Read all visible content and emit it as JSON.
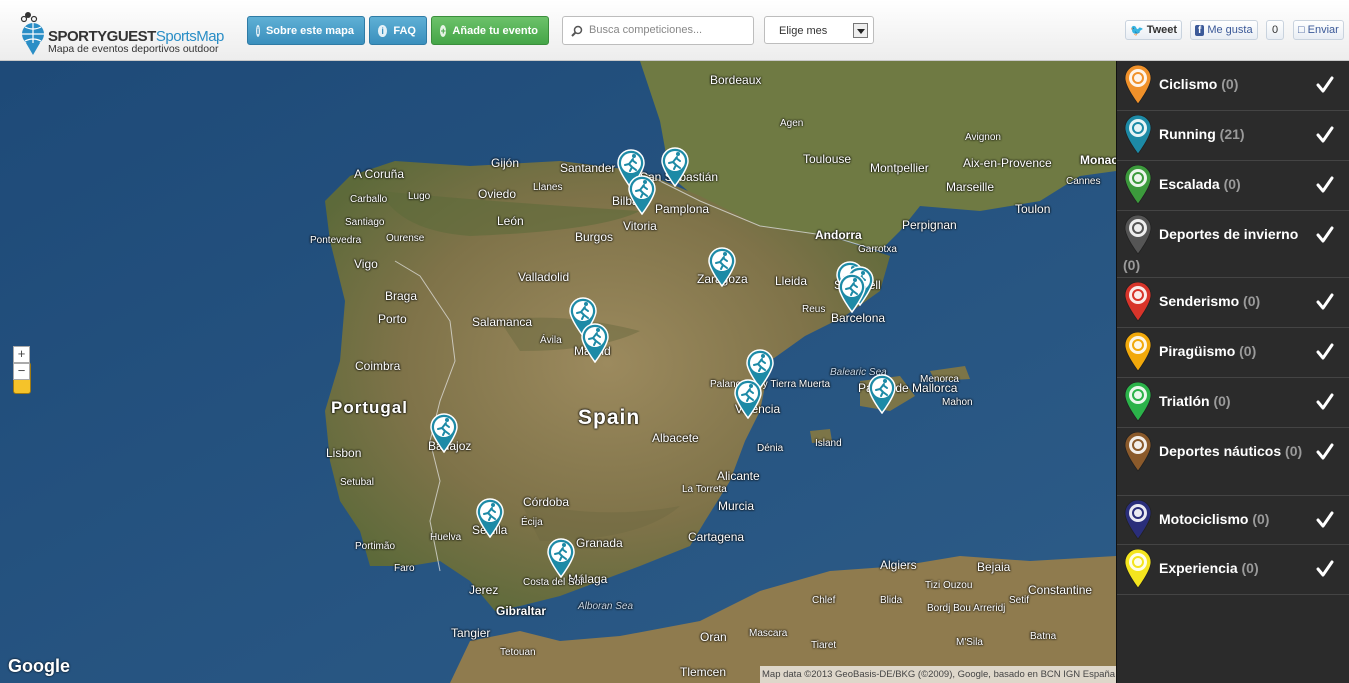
{
  "header": {
    "logo": {
      "brand_main": "SPORTYGUEST",
      "brand_accent": "SportsMap",
      "tagline": "Mapa de eventos deportivos outdoor"
    },
    "buttons": {
      "about": "Sobre este mapa",
      "faq": "FAQ",
      "add_event": "Añade tu evento"
    },
    "search": {
      "placeholder": "Busca competiciones..."
    },
    "month_select": {
      "value": "Elige mes"
    },
    "social": {
      "tweet": "Tweet",
      "like": "Me gusta",
      "like_count": "0",
      "send": "Enviar"
    }
  },
  "map": {
    "labels": {
      "countries": [
        "Portugal",
        "Spain"
      ],
      "cities": [
        "Bordeaux",
        "Agen",
        "Toulouse",
        "Montpellier",
        "Avignon",
        "Aix-en-Provence",
        "Monaco",
        "Marseille",
        "Cannes",
        "Toulon",
        "Perpignan",
        "Andorra",
        "Garrotxa",
        "A Coruña",
        "Gijón",
        "Santander",
        "San Sebastián",
        "Carballo",
        "Lugo",
        "Oviedo",
        "Llanes",
        "Bilbao",
        "Pamplona",
        "Santiago",
        "Vitoria",
        "Pontevedra",
        "Ourense",
        "León",
        "Burgos",
        "Vigo",
        "Valladolid",
        "Zaragoza",
        "Lleida",
        "Sabadell",
        "Braga",
        "Porto",
        "Salamanca",
        "Reus",
        "Barcelona",
        "Ávila",
        "Madrid",
        "Coimbra",
        "Palancares y Tierra Muerta",
        "Valencia",
        "Palma de Mallorca",
        "Menorca",
        "Mahon",
        "Lisbon",
        "Badajoz",
        "Albacete",
        "Island",
        "Dénia",
        "Setubal",
        "Córdoba",
        "Alicante",
        "La Torreta",
        "Écija",
        "Murcia",
        "Sevilla",
        "Huelva",
        "Granada",
        "Portimão",
        "Cartagena",
        "Faro",
        "Jerez",
        "Málaga",
        "Costa del Sol",
        "Gibraltar",
        "Algiers",
        "Bejaia",
        "Tizi Ouzou",
        "Constantine",
        "Chlef",
        "Blida",
        "Setif",
        "Bordj Bou Arreridj",
        "Tangier",
        "Tetouan",
        "Oran",
        "Mascara",
        "Tiaret",
        "M'Sila",
        "Tlemcen",
        "Batna"
      ],
      "seas": [
        "Alboran Sea",
        "Balearic Sea"
      ]
    },
    "google_logo": "Google",
    "copyright": "Map data ©2013 GeoBasis-DE/BKG (©2009), Google, basado en BCN IGN España"
  },
  "categories": [
    {
      "name": "Ciclismo",
      "count": "(0)",
      "color": "#f0912a",
      "icon": "bicycle-icon",
      "checked": true
    },
    {
      "name": "Running",
      "count": "(21)",
      "color": "#1d8aa6",
      "icon": "runner-icon",
      "checked": true
    },
    {
      "name": "Escalada",
      "count": "(0)",
      "color": "#3c9a3c",
      "icon": "climber-icon",
      "checked": true
    },
    {
      "name": "Deportes de invierno",
      "count": "(0)",
      "color": "#555555",
      "icon": "snowflake-icon",
      "checked": true
    },
    {
      "name": "Senderismo",
      "count": "(0)",
      "color": "#d8342a",
      "icon": "hiker-icon",
      "checked": true
    },
    {
      "name": "Piragüismo",
      "count": "(0)",
      "color": "#f2a90b",
      "icon": "canoe-icon",
      "checked": true
    },
    {
      "name": "Triatlón",
      "count": "(0)",
      "color": "#2bb34a",
      "icon": "triathlon-icon",
      "checked": true
    },
    {
      "name": "Deportes náuticos",
      "count": "(0)",
      "color": "#8b5a2b",
      "icon": "sailboat-icon",
      "checked": true
    },
    {
      "name": "Motociclismo",
      "count": "(0)",
      "color": "#2a2e7a",
      "icon": "motorcycle-icon",
      "checked": true
    },
    {
      "name": "Experiencia",
      "count": "(0)",
      "color": "#f4e51e",
      "icon": "star-icon",
      "checked": true
    }
  ],
  "colors": {
    "running_marker": "#1d8aa6",
    "land": "#8a7a55",
    "sea": "#27527e"
  }
}
